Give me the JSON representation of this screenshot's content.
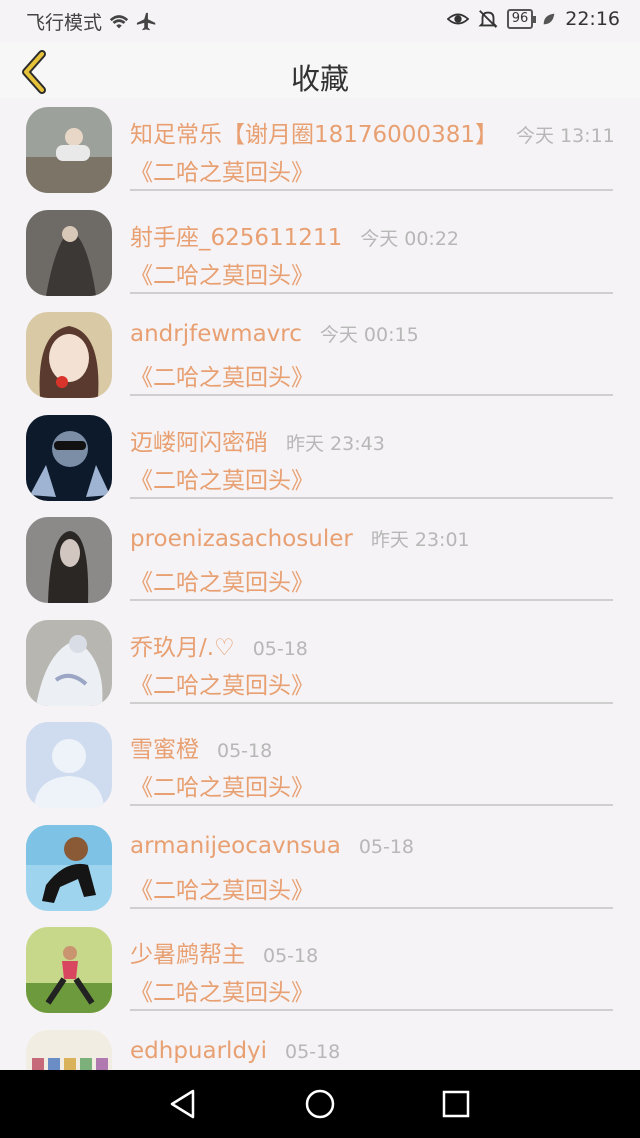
{
  "status_bar": {
    "airplane_mode_label": "飞行模式",
    "battery_level": "96",
    "time": "22:16"
  },
  "nav": {
    "title": "收藏"
  },
  "favorites": [
    {
      "name": "知足常乐【谢月圈18176000381】",
      "time": "今天 13:11",
      "novel": "《二哈之莫回头》"
    },
    {
      "name": "射手座_625611211",
      "time": "今天 00:22",
      "novel": "《二哈之莫回头》"
    },
    {
      "name": "andrjfewmavrc",
      "time": "今天 00:15",
      "novel": "《二哈之莫回头》"
    },
    {
      "name": "迈嵝阿闪密硝",
      "time": "昨天 23:43",
      "novel": "《二哈之莫回头》"
    },
    {
      "name": "proenizasachosuler",
      "time": "昨天 23:01",
      "novel": "《二哈之莫回头》"
    },
    {
      "name": "乔玖月/.♡",
      "time": "05-18",
      "novel": "《二哈之莫回头》"
    },
    {
      "name": "雪蜜橙",
      "time": "05-18",
      "novel": "《二哈之莫回头》"
    },
    {
      "name": "armanijeocavnsua",
      "time": "05-18",
      "novel": "《二哈之莫回头》"
    },
    {
      "name": "少暑鹧帮主",
      "time": "05-18",
      "novel": "《二哈之莫回头》"
    },
    {
      "name": "edhpuarldyi",
      "time": "05-18",
      "novel": ""
    }
  ],
  "colors": {
    "accent": "#e8a072",
    "back_arrow": "#e6c23a",
    "timestamp": "#b7b7b7"
  }
}
